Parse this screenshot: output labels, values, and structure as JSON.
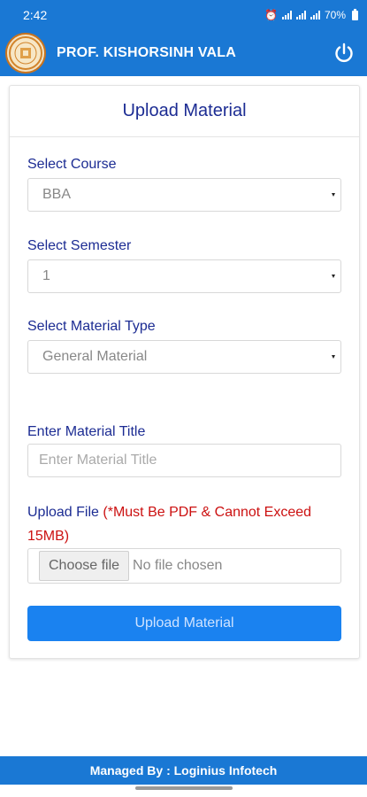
{
  "status": {
    "time": "2:42",
    "battery": "70%"
  },
  "header": {
    "title": "PROF. KISHORSINH VALA"
  },
  "card": {
    "title": "Upload Material"
  },
  "form": {
    "course_label": "Select Course",
    "course_value": "BBA",
    "semester_label": "Select Semester",
    "semester_value": "1",
    "type_label": "Select Material Type",
    "type_value": "General Material",
    "title_label": "Enter Material Title",
    "title_placeholder": "Enter Material Title",
    "file_label": "Upload File",
    "file_warning": "(*Must Be PDF & Cannot Exceed 15MB)",
    "choose_label": "Choose file",
    "no_file": "No file chosen",
    "submit_label": "Upload Material"
  },
  "footer": {
    "text": "Managed By : Loginius Infotech"
  },
  "colors": {
    "primary": "#1a78d4",
    "label": "#1c2c93",
    "warning": "#cc1111",
    "button": "#1a82f0"
  }
}
